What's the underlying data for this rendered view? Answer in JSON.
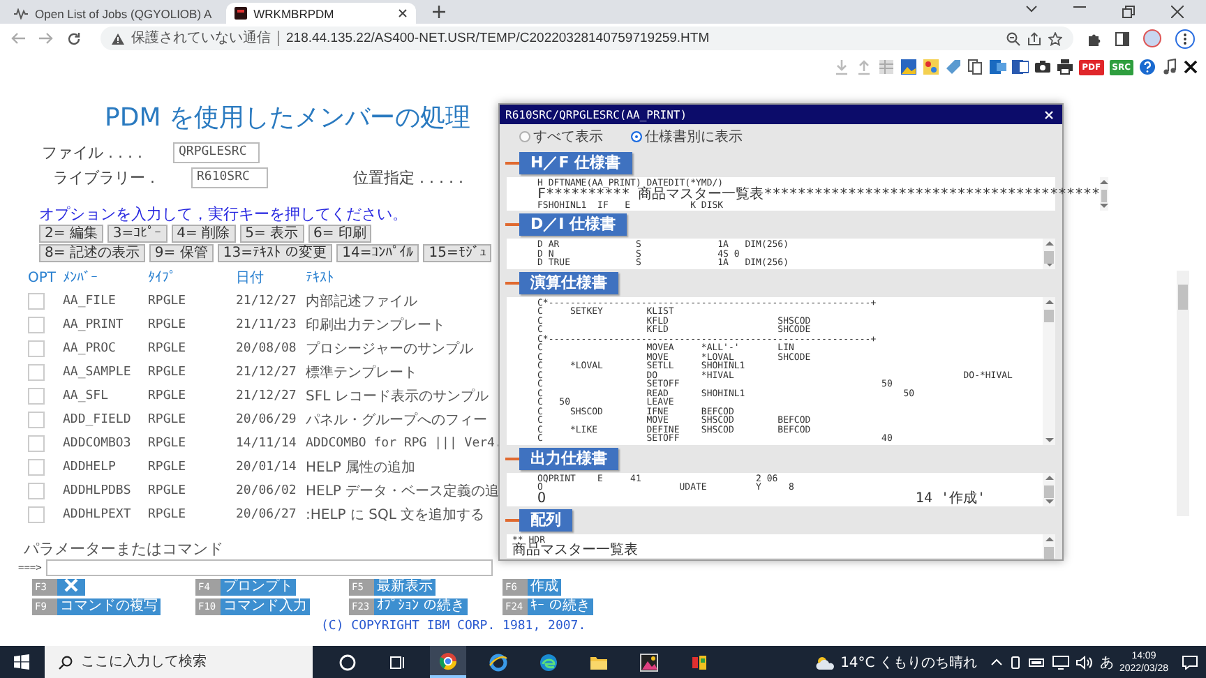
{
  "browser": {
    "tabs": [
      {
        "title": "Open List of Jobs (QGYOLIOB) A",
        "selected": false
      },
      {
        "title": "WRKMBRPDM",
        "selected": true
      }
    ],
    "security_label": "保護されていない通信",
    "url": "218.44.135.22/AS400-NET.USR/TEMP/C20220328140759719259.HTM"
  },
  "page_toolbar": {
    "badges": [
      {
        "text": "PDF",
        "color": "#e0262a"
      },
      {
        "text": "SRC",
        "color": "#2e9e3e"
      }
    ]
  },
  "pdm": {
    "title": "PDM を使用したメンバーの処理",
    "fields": [
      {
        "label": "ファイル . . . .",
        "value": "QRPGLESRC"
      },
      {
        "label": "ライブラリー .",
        "value": "R610SRC"
      }
    ],
    "position_label": "位置指定 . . . . .",
    "instruction": "オプションを入力して，実行キーを押してください。",
    "options": [
      [
        "2= 編集",
        "3=ｺﾋﾟｰ",
        "4= 削除",
        "5= 表示",
        "6= 印刷"
      ],
      [
        "8= 記述の表示",
        "9= 保管",
        "13=ﾃｷｽﾄ の変更",
        "14=ｺﾝﾊﾟｲﾙ",
        "15=ﾓｼﾞｭ"
      ]
    ],
    "columns": [
      "OPT",
      "ﾒﾝﾊﾞｰ",
      "ﾀｲﾌﾟ",
      "日付",
      "ﾃｷｽﾄ"
    ],
    "rows": [
      {
        "member": "AA_FILE",
        "type": "RPGLE",
        "date": "21/12/27",
        "text": "内部記述ファイル"
      },
      {
        "member": "AA_PRINT",
        "type": "RPGLE",
        "date": "21/11/23",
        "text": "印刷出力テンプレート"
      },
      {
        "member": "AA_PROC",
        "type": "RPGLE",
        "date": "20/08/08",
        "text": "プロシージャーのサンプル"
      },
      {
        "member": "AA_SAMPLE",
        "type": "RPGLE",
        "date": "21/12/27",
        "text": "標準テンプレート"
      },
      {
        "member": "AA_SFL",
        "type": "RPGLE",
        "date": "21/12/27",
        "text": "SFL レコード表示のサンプル"
      },
      {
        "member": "ADD_FIELD",
        "type": "RPGLE",
        "date": "20/06/29",
        "text": "パネル・グループへのフィー"
      },
      {
        "member": "ADDCOMBO3",
        "type": "RPGLE",
        "date": "14/11/14",
        "text": "ADDCOMBO for RPG ||| Ver4."
      },
      {
        "member": "ADDHELP",
        "type": "RPGLE",
        "date": "20/01/14",
        "text": "HELP 属性の追加"
      },
      {
        "member": "ADDHLPDBS",
        "type": "RPGLE",
        "date": "20/06/02",
        "text": "HELP データ・ベース定義の追"
      },
      {
        "member": "ADDHLPEXT",
        "type": "RPGLE",
        "date": "20/06/27",
        "text": ":HELP に SQL 文を追加する"
      }
    ],
    "command_label": "パラメーターまたはコマンド",
    "prompt": "===>",
    "function_keys": [
      {
        "key": "F3",
        "kind": "icon"
      },
      {
        "key": "F4",
        "kind": "text",
        "label": "プロンプト"
      },
      {
        "key": "F5",
        "kind": "text",
        "label": "最新表示"
      },
      {
        "key": "F6",
        "kind": "text",
        "label": "作成"
      },
      {
        "key": "F9",
        "kind": "text",
        "label": "コマンドの複写"
      },
      {
        "key": "F10",
        "kind": "text",
        "label": "コマンド入力"
      },
      {
        "key": "F23",
        "kind": "text",
        "label": "ｵﾌﾟｼｮﾝ の続き"
      },
      {
        "key": "F24",
        "kind": "text",
        "label": "ｷｰ の続き"
      }
    ],
    "copyright": "(C) COPYRIGHT IBM CORP. 1981, 2007."
  },
  "popup": {
    "title": "R610SRC/QRPGLESRC(AA_PRINT)",
    "view_options": [
      {
        "label": "すべて表示",
        "selected": false
      },
      {
        "label": "仕様書別に表示",
        "selected": true
      }
    ],
    "sections": [
      {
        "title": "H／F 仕様書",
        "kind": "spec",
        "lines": [
          "H DFTNAME(AA_PRINT) DATEDIT(*YMD/)",
          "F********** 商品マスター一覧表****************************************",
          "FSHOHINL1  IF   E           K DISK"
        ]
      },
      {
        "title": "D／I 仕様書",
        "kind": "spec",
        "lines": [
          "D AR              S              1A   DIM(256)",
          "D N               S              4S 0",
          "D TRUE            S              1A   DIM(256)"
        ]
      },
      {
        "title": "演算仕様書",
        "kind": "spec",
        "lines": [
          "C*-----------------------------------------------------------+",
          "C     SETKEY        KLIST",
          "C                   KFLD                    SHSCOD",
          "C                   KFLD                    SHCODE",
          "C*-----------------------------------------------------------+",
          "C                   MOVEA     *ALL'-'       LIN",
          "C                   MOVE      *LOVAL        SHCODE",
          "C     *LOVAL        SETLL     SHOHINL1",
          "C                   DO        *HIVAL                                          DO-*HIVAL",
          "C                   SETOFF                                     50",
          "C                   READ      SHOHINL1                             50",
          "C   50              LEAVE",
          "C     SHSCOD        IFNE      BEFCOD",
          "C                   MOVE      SHSCOD        BEFCOD",
          "C     *LIKE         DEFINE    SHSCOD        BEFCOD",
          "C                   SETOFF                                     40"
        ]
      },
      {
        "title": "出力仕様書",
        "kind": "spec",
        "lines": [
          "OQPRINT    E     41                     2 06",
          "O                         UDATE         Y     8",
          "O                                            14 '作成'"
        ]
      },
      {
        "title": "配列",
        "kind": "array",
        "lines": [
          "** HDR",
          "商品マスター一覧表"
        ]
      }
    ]
  },
  "taskbar": {
    "search_placeholder": "ここに入力して検索",
    "weather": "14°C くもりのち晴れ",
    "ime": "あ",
    "time": "14:09",
    "date": "2022/03/28"
  }
}
